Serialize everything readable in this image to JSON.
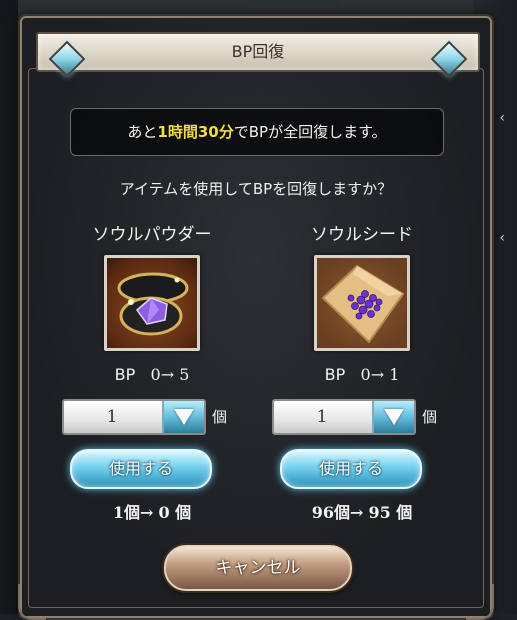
{
  "dialog": {
    "title": "BP回復",
    "info": {
      "prefix": "あと",
      "time_highlight": "1時間30分",
      "suffix": "でBPが全回復します。"
    },
    "question": "アイテムを使用してBPを回復しますか？",
    "items": [
      {
        "name": "ソウルパウダー",
        "icon": "soul-powder-icon",
        "bp_label": "BP",
        "bp_change": "0→ 5",
        "quantity": "1",
        "unit": "個",
        "use_label": "使用する",
        "count_before": "1個→",
        "count_after": "0 個"
      },
      {
        "name": "ソウルシード",
        "icon": "soul-seed-icon",
        "bp_label": "BP",
        "bp_change": "0→ 1",
        "quantity": "1",
        "unit": "個",
        "use_label": "使用する",
        "count_before": "96個→",
        "count_after": "95 個"
      }
    ],
    "cancel_label": "キャンセル"
  },
  "colors": {
    "highlight": "#f3dc3c",
    "use_button": "#5fb7d6",
    "cancel_button": "#a77e64",
    "frame": "#8d8170"
  }
}
